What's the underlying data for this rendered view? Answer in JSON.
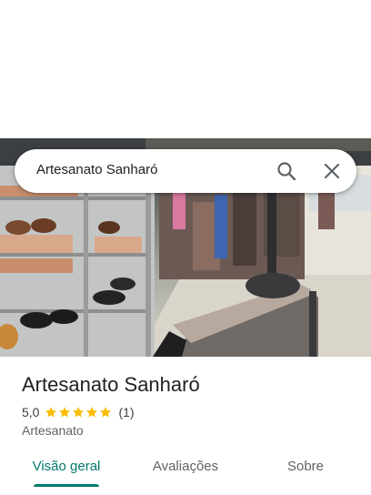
{
  "search": {
    "query": "Artesanato Sanharó",
    "search_icon": "search-icon",
    "close_icon": "close-icon"
  },
  "place": {
    "name": "Artesanato Sanharó",
    "rating": "5,0",
    "stars": 5,
    "review_count": "(1)",
    "category": "Artesanato"
  },
  "tabs": [
    {
      "label": "Visão geral",
      "active": true
    },
    {
      "label": "Avaliações",
      "active": false
    },
    {
      "label": "Sobre",
      "active": false
    }
  ],
  "colors": {
    "accent": "#00796b",
    "star": "#fbbc04"
  }
}
